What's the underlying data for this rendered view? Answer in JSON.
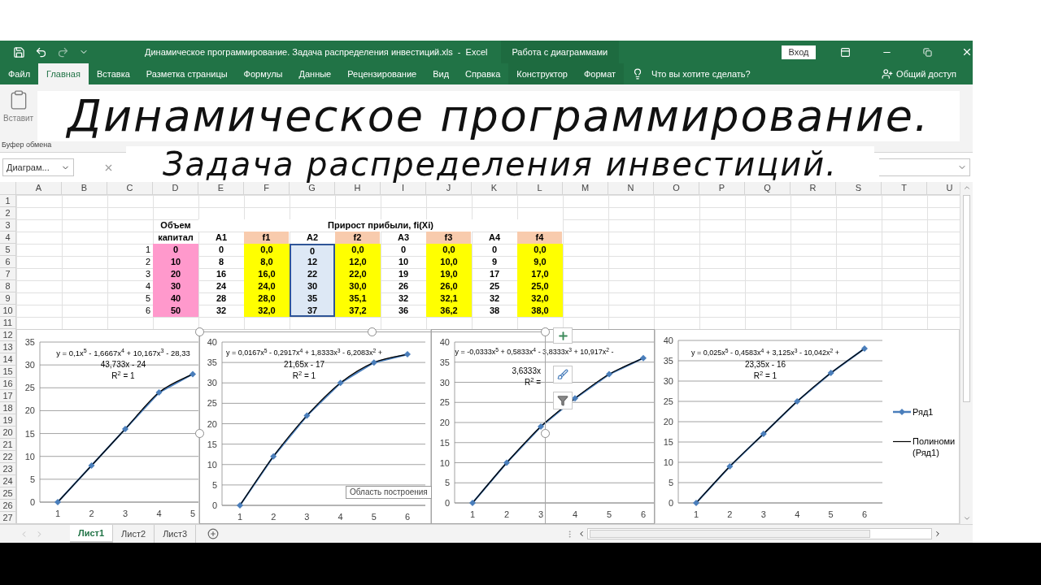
{
  "title_bar": {
    "title": "Динамическое программирование. Задача распределения инвестиций.xls  -  Excel",
    "context": "Работа с диаграммами",
    "sign_in": "Вход"
  },
  "tabs": [
    {
      "label": "Файл",
      "selected": false,
      "kind": "normal"
    },
    {
      "label": "Главная",
      "selected": true,
      "kind": "normal"
    },
    {
      "label": "Вставка",
      "selected": false,
      "kind": "normal"
    },
    {
      "label": "Разметка страницы",
      "selected": false,
      "kind": "normal"
    },
    {
      "label": "Формулы",
      "selected": false,
      "kind": "normal"
    },
    {
      "label": "Данные",
      "selected": false,
      "kind": "normal"
    },
    {
      "label": "Рецензирование",
      "selected": false,
      "kind": "normal"
    },
    {
      "label": "Вид",
      "selected": false,
      "kind": "normal"
    },
    {
      "label": "Справка",
      "selected": false,
      "kind": "normal"
    },
    {
      "label": "Конструктор",
      "selected": false,
      "kind": "context"
    },
    {
      "label": "Формат",
      "selected": false,
      "kind": "context"
    }
  ],
  "tell_me": "Что вы хотите сделать?",
  "share": "Общий доступ",
  "ribbon": {
    "paste": "Вставит",
    "group": "Буфер обмена"
  },
  "formula_bar": {
    "name_box": "Диаграм..."
  },
  "overlay": [
    "Динамическое программирование.",
    "Задача распределения инвестиций."
  ],
  "sheet": {
    "columns": [
      "A",
      "B",
      "C",
      "D",
      "E",
      "F",
      "G",
      "H",
      "I",
      "J",
      "K",
      "L",
      "M",
      "N",
      "O",
      "P",
      "Q",
      "R",
      "S",
      "T",
      "U"
    ],
    "rows": [
      "1",
      "2",
      "3",
      "4",
      "5",
      "6",
      "7",
      "8",
      "9",
      "10",
      "11",
      "12",
      "13",
      "14",
      "15",
      "16",
      "17",
      "18",
      "19",
      "20",
      "21",
      "22",
      "23",
      "24",
      "25",
      "26",
      "27"
    ]
  },
  "table": {
    "capital_header": [
      "Объем",
      "капитал"
    ],
    "group_header": "Прирост прибыли, fi(Xi)",
    "columns": [
      {
        "label": "A1",
        "kind": "a",
        "selected": false
      },
      {
        "label": "f1",
        "kind": "f",
        "selected": false
      },
      {
        "label": "A2",
        "kind": "a",
        "selected": true
      },
      {
        "label": "f2",
        "kind": "f",
        "selected": false
      },
      {
        "label": "A3",
        "kind": "a",
        "selected": false
      },
      {
        "label": "f3",
        "kind": "f",
        "selected": false
      },
      {
        "label": "A4",
        "kind": "a",
        "selected": false
      },
      {
        "label": "f4",
        "kind": "f",
        "selected": false
      }
    ],
    "rows": [
      {
        "index": "1",
        "capital": "0",
        "values": [
          "0",
          "0,0",
          "0",
          "0,0",
          "0",
          "0,0",
          "0",
          "0,0"
        ]
      },
      {
        "index": "2",
        "capital": "10",
        "values": [
          "8",
          "8,0",
          "12",
          "12,0",
          "10",
          "10,0",
          "9",
          "9,0"
        ]
      },
      {
        "index": "3",
        "capital": "20",
        "values": [
          "16",
          "16,0",
          "22",
          "22,0",
          "19",
          "19,0",
          "17",
          "17,0"
        ]
      },
      {
        "index": "4",
        "capital": "30",
        "values": [
          "24",
          "24,0",
          "30",
          "30,0",
          "26",
          "26,0",
          "25",
          "25,0"
        ]
      },
      {
        "index": "5",
        "capital": "40",
        "values": [
          "28",
          "28,0",
          "35",
          "35,1",
          "32",
          "32,1",
          "32",
          "32,0"
        ]
      },
      {
        "index": "6",
        "capital": "50",
        "values": [
          "32",
          "32,0",
          "37",
          "37,2",
          "36",
          "36,2",
          "38",
          "38,0"
        ]
      }
    ]
  },
  "charts": [
    {
      "selected": false,
      "equation": [
        "y = 0,1x$^{5}$ - 1,6667x$^{4}$ + 10,167x$^{3}$ - 28,33",
        "43,733x - 24"
      ],
      "r2": "R$^{2}$ = 1",
      "chart_data": {
        "type": "line",
        "categories": [
          "1",
          "2",
          "3",
          "4",
          "5"
        ],
        "series": [
          {
            "color": "#4a7ebb",
            "marker": "diamond",
            "values": [
              0,
              8,
              16,
              24,
              28
            ]
          }
        ],
        "ylim": [
          0,
          35
        ],
        "yticks": [
          0,
          5,
          10,
          15,
          20,
          25,
          30,
          35
        ],
        "grid": true
      }
    },
    {
      "selected": false,
      "equation": [
        "y = 0,0167x$^{5}$ - 0,2917x$^{4}$ + 1,8333x$^{3}$ - 6,2083x$^{2}$ +",
        "21,65x - 17"
      ],
      "r2": "R$^{2}$ = 1",
      "chart_data": {
        "type": "line",
        "categories": [
          "1",
          "2",
          "3",
          "4",
          "5",
          "6"
        ],
        "series": [
          {
            "color": "#4a7ebb",
            "marker": "diamond",
            "values": [
              0,
              12,
              22,
              30,
              35,
              37
            ]
          }
        ],
        "ylim": [
          0,
          40
        ],
        "yticks": [
          0,
          5,
          10,
          15,
          20,
          25,
          30,
          35,
          40
        ],
        "grid": true
      }
    },
    {
      "selected": true,
      "equation": [
        "y = -0,0333x$^{5}$ + 0,5833x$^{4}$ - 3,8333x$^{3}$ + 10,917x$^{2}$ -",
        "3,6333x"
      ],
      "r2": "R$^{2}$ =",
      "chart_data": {
        "type": "line",
        "categories": [
          "1",
          "2",
          "3",
          "4",
          "5",
          "6"
        ],
        "series": [
          {
            "color": "#4a7ebb",
            "marker": "diamond",
            "values": [
              0,
              10,
              19,
              26,
              32,
              36
            ]
          }
        ],
        "ylim": [
          0,
          40
        ],
        "yticks": [
          0,
          5,
          10,
          15,
          20,
          25,
          30,
          35,
          40
        ],
        "grid": true
      }
    },
    {
      "selected": false,
      "equation": [
        "y = 0,025x$^{5}$ - 0,4583x$^{4}$ + 3,125x$^{3}$ - 10,042x$^{2}$ +",
        "23,35x - 16"
      ],
      "r2": "R$^{2}$ = 1",
      "chart_data": {
        "type": "line",
        "categories": [
          "1",
          "2",
          "3",
          "4",
          "5",
          "6"
        ],
        "series": [
          {
            "name": "Ряд1",
            "color": "#4a7ebb",
            "marker": "diamond",
            "values": [
              0,
              9,
              17,
              25,
              32,
              38
            ]
          }
        ],
        "ylim": [
          0,
          40
        ],
        "yticks": [
          0,
          5,
          10,
          15,
          20,
          25,
          30,
          35,
          40
        ],
        "grid": true
      },
      "legend": [
        {
          "kind": "trend",
          "lines": [
            "Полиноми",
            "(Ряд1)"
          ]
        }
      ]
    }
  ],
  "tooltip": "Область построения",
  "sheet_tabs": [
    {
      "label": "Лист1",
      "selected": true
    },
    {
      "label": "Лист2",
      "selected": false
    },
    {
      "label": "Лист3",
      "selected": false
    }
  ]
}
